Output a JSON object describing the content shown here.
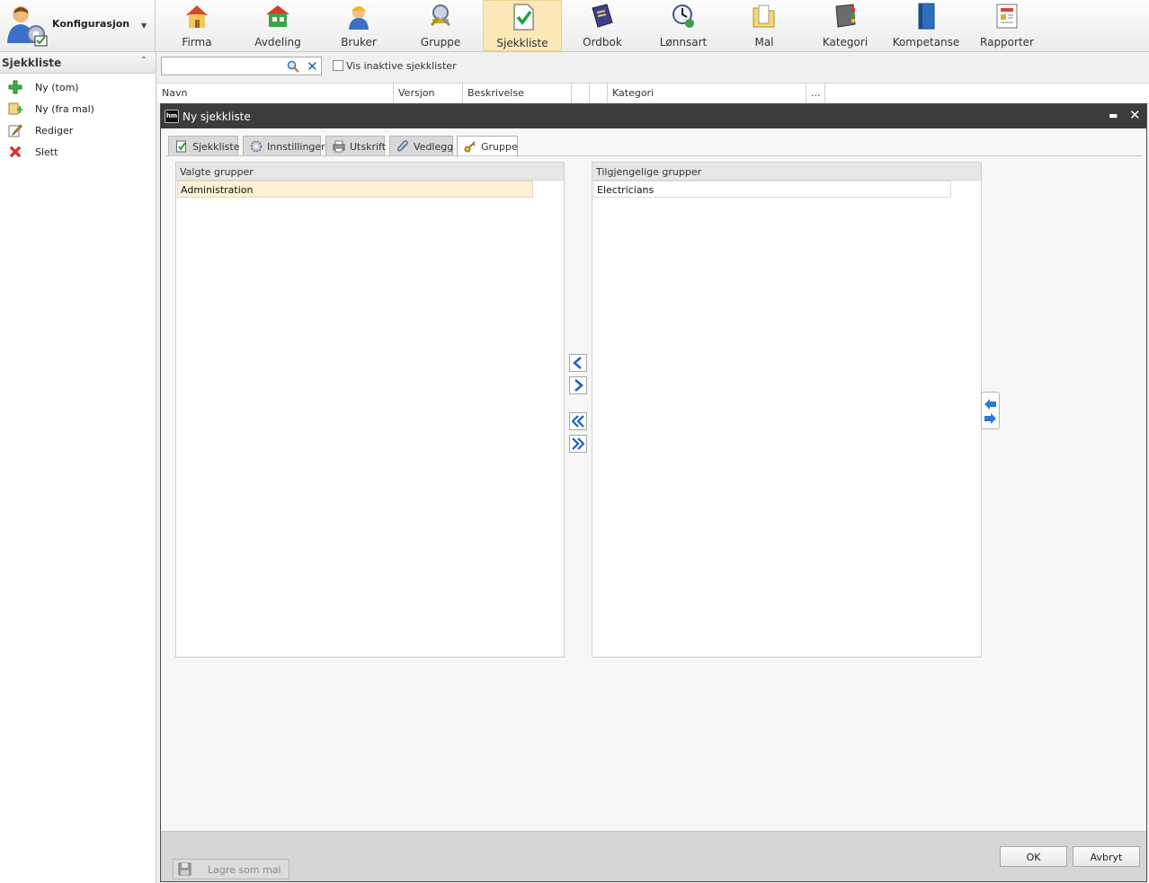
{
  "app_menu": {
    "name": "Konfigurasjon"
  },
  "toolbar": [
    {
      "label": "Firma",
      "icon": "house-icon"
    },
    {
      "label": "Avdeling",
      "icon": "department-icon"
    },
    {
      "label": "Bruker",
      "icon": "worker-icon"
    },
    {
      "label": "Gruppe",
      "icon": "group-keys-icon"
    },
    {
      "label": "Sjekkliste",
      "icon": "checklist-icon",
      "active": true
    },
    {
      "label": "Ordbok",
      "icon": "dictionary-icon"
    },
    {
      "label": "Lønnsart",
      "icon": "wage-clock-icon"
    },
    {
      "label": "Mal",
      "icon": "template-folder-icon"
    },
    {
      "label": "Kategori",
      "icon": "category-book-icon"
    },
    {
      "label": "Kompetanse",
      "icon": "competence-book-icon"
    },
    {
      "label": "Rapporter",
      "icon": "report-icon"
    }
  ],
  "sidebar": {
    "title": "Sjekkliste",
    "items": [
      {
        "label": "Ny (tom)",
        "icon": "add-icon"
      },
      {
        "label": "Ny (fra mal)",
        "icon": "new-from-template-icon"
      },
      {
        "label": "Rediger",
        "icon": "edit-icon"
      },
      {
        "label": "Slett",
        "icon": "delete-icon"
      }
    ]
  },
  "search": {
    "value": "",
    "placeholder": ""
  },
  "show_inactive": {
    "label": "Vis inaktive sjekklister",
    "checked": false
  },
  "grid": {
    "columns": [
      "Navn",
      "Versjon",
      "Beskrivelse",
      "",
      "",
      "Kategori",
      "..."
    ]
  },
  "dialog": {
    "title": "Ny sjekkliste",
    "tabs": [
      {
        "label": "Sjekkliste",
        "icon": "checklist-icon"
      },
      {
        "label": "Innstillinger",
        "icon": "settings-icon"
      },
      {
        "label": "Utskrift",
        "icon": "printer-icon"
      },
      {
        "label": "Vedlegg",
        "icon": "paperclip-icon"
      },
      {
        "label": "Gruppe",
        "icon": "keys-icon",
        "active": true
      }
    ],
    "selected_groups": {
      "header": "Valgte grupper",
      "items": [
        "Administration"
      ]
    },
    "available_groups": {
      "header": "Tilgjengelige grupper",
      "items": [
        "Electricians"
      ]
    },
    "footer": {
      "save_template": "Lagre som mal",
      "ok": "OK",
      "cancel": "Avbryt"
    }
  },
  "colors": {
    "active_tab": "#fbe7b7",
    "selected_row": "#fdf1d6",
    "dialog_title": "#3c3c3c",
    "arrow_blue": "#1a5fc8"
  }
}
